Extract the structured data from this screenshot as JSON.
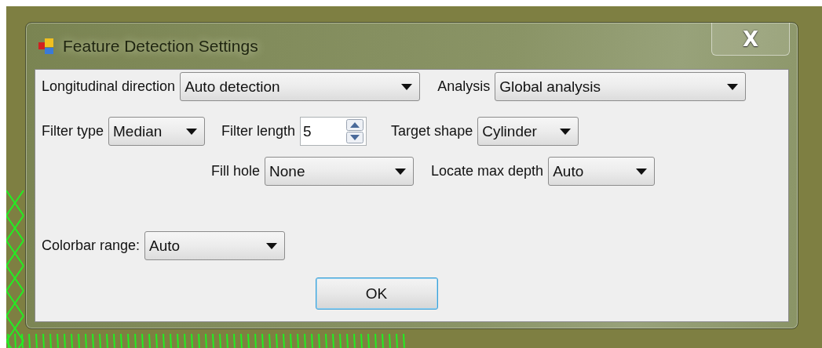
{
  "window": {
    "title": "Feature Detection Settings",
    "close_label": "X"
  },
  "rows": [
    [
      {
        "label": "Longitudinal direction",
        "kind": "combo",
        "value": "Auto detection"
      },
      {
        "label": "Analysis",
        "kind": "combo",
        "value": "Global analysis"
      }
    ],
    [
      {
        "label": "Filter type",
        "kind": "combo",
        "value": "Median"
      },
      {
        "label": "Filter length",
        "kind": "spin",
        "value": "5"
      },
      {
        "label": "Target shape",
        "kind": "combo",
        "value": "Cylinder"
      }
    ],
    [
      {
        "label": "Fill hole",
        "kind": "combo",
        "value": "None"
      },
      {
        "label": "Locate max depth",
        "kind": "combo",
        "value": "Auto"
      }
    ],
    [
      {
        "label": "Colorbar range:",
        "kind": "combo",
        "value": "Auto"
      }
    ]
  ],
  "buttons": [
    {
      "label": "OK",
      "focused": true
    }
  ]
}
